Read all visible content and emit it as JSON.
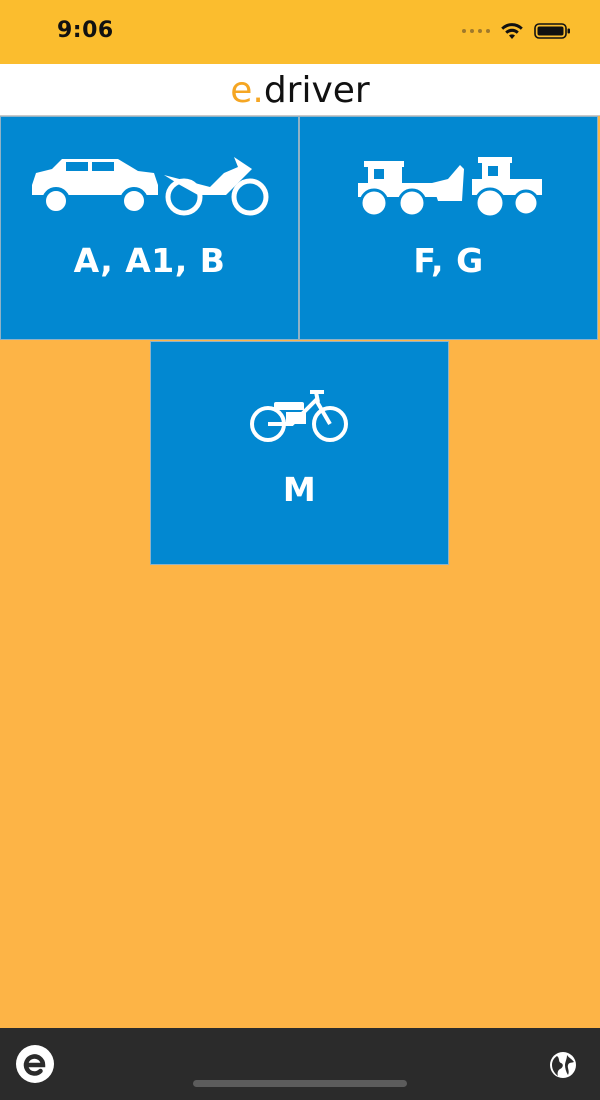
{
  "status_bar": {
    "time": "9:06"
  },
  "header": {
    "brand_prefix": "e.",
    "brand_suffix": "driver"
  },
  "tiles": [
    {
      "label": "A, A1, B",
      "icons": [
        "car-icon",
        "motorcycle-icon"
      ]
    },
    {
      "label": "F, G",
      "icons": [
        "loader-tractor-icon",
        "tractor-icon"
      ]
    },
    {
      "label": "M",
      "icons": [
        "moped-icon"
      ]
    }
  ],
  "bottom_bar": {
    "left_icon": "e-logo-icon",
    "right_icon": "globe-icon"
  },
  "colors": {
    "status_bar": "#fbbd2e",
    "background": "#fdb446",
    "tile": "#0288d1",
    "bottom_bar": "#2b2b2b",
    "brand_accent": "#f5a623"
  }
}
